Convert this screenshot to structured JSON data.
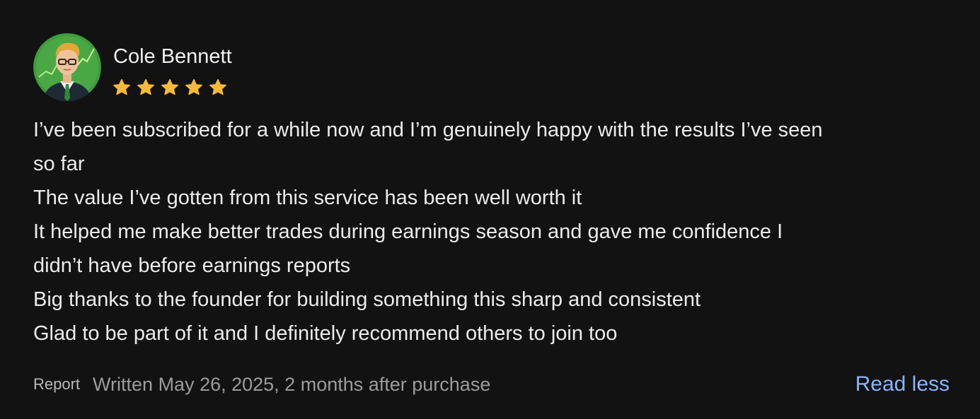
{
  "review": {
    "author": "Cole Bennett",
    "rating": 5,
    "rating_max": 5,
    "star_color": "#f6b93b",
    "lines": [
      "I’ve been subscribed for a while now and I’m genuinely happy with the results I’ve seen",
      "so far",
      "The value I’ve gotten from this service has been well worth it",
      "It helped me make better trades during earnings season and gave me confidence I",
      "didn’t have before earnings reports",
      "Big thanks to the founder for building something this sharp and consistent",
      "Glad to be part of it and I definitely recommend others to join too"
    ],
    "report_label": "Report",
    "written_meta": "Written May 26, 2025, 2 months after purchase",
    "read_less_label": "Read less"
  },
  "colors": {
    "background": "#121212",
    "link": "#8ab4f8",
    "avatar_bg": "#3f9c3a"
  }
}
